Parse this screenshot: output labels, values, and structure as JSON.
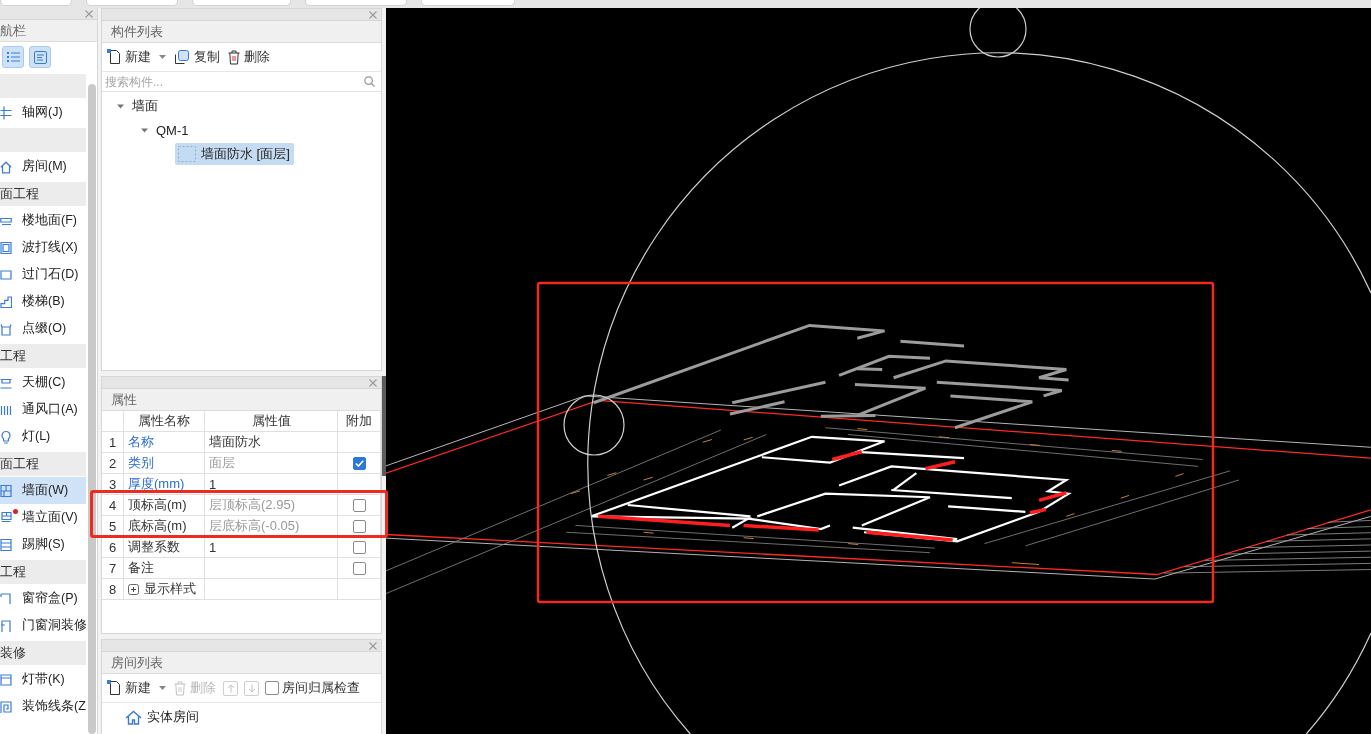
{
  "sidebar": {
    "title": "航栏",
    "groups": [
      {
        "items": [
          {
            "label": "轴网(J)",
            "selected": false,
            "alert_dot": false
          }
        ]
      },
      {
        "items": [
          {
            "label": "房间(M)",
            "selected": false,
            "alert_dot": false
          }
        ]
      },
      {
        "title": "面工程",
        "items": [
          {
            "label": "楼地面(F)",
            "selected": false,
            "alert_dot": false
          },
          {
            "label": "波打线(X)",
            "selected": false,
            "alert_dot": false
          },
          {
            "label": "过门石(D)",
            "selected": false,
            "alert_dot": false
          },
          {
            "label": "楼梯(B)",
            "selected": false,
            "alert_dot": false
          },
          {
            "label": "点缀(O)",
            "selected": false,
            "alert_dot": false
          }
        ]
      },
      {
        "title": "工程",
        "items": [
          {
            "label": "天棚(C)",
            "selected": false,
            "alert_dot": false
          },
          {
            "label": "通风口(A)",
            "selected": false,
            "alert_dot": false
          },
          {
            "label": "灯(L)",
            "selected": false,
            "alert_dot": false
          }
        ]
      },
      {
        "title": "面工程",
        "items": [
          {
            "label": "墙面(W)",
            "selected": true,
            "alert_dot": false
          },
          {
            "label": "墙立面(V)",
            "selected": false,
            "alert_dot": true
          },
          {
            "label": "踢脚(S)",
            "selected": false,
            "alert_dot": false
          }
        ]
      },
      {
        "title": "工程",
        "items": [
          {
            "label": "窗帘盒(P)",
            "selected": false,
            "alert_dot": false
          },
          {
            "label": "门窗洞装修",
            "selected": false,
            "alert_dot": false
          }
        ]
      },
      {
        "title": "装修",
        "items": [
          {
            "label": "灯带(K)",
            "selected": false,
            "alert_dot": false
          },
          {
            "label": "装饰线条(Z",
            "selected": false,
            "alert_dot": false
          }
        ]
      }
    ]
  },
  "component_list": {
    "title": "构件列表",
    "toolbar": [
      {
        "kind": "new",
        "label": "新建",
        "disabled": false
      },
      {
        "kind": "copy",
        "label": "复制",
        "disabled": false
      },
      {
        "kind": "delete",
        "label": "删除",
        "disabled": false
      }
    ],
    "search": {
      "placeholder": "搜索构件..."
    },
    "tree": [
      {
        "label": "墙面",
        "expanded": true,
        "selected": false,
        "children": [
          {
            "label": "QM-1",
            "expanded": true,
            "selected": false,
            "children": [
              {
                "label": "墙面防水 [面层]",
                "selected": true
              }
            ]
          }
        ]
      }
    ]
  },
  "properties": {
    "title": "属性",
    "columns": [
      "属性名称",
      "属性值",
      "附加"
    ],
    "rows": [
      {
        "index": "1",
        "name": "名称",
        "public": true,
        "value": "墙面防水",
        "inherited": false
      },
      {
        "index": "2",
        "name": "类别",
        "public": true,
        "value": "面层",
        "inherited": true,
        "attached": true
      },
      {
        "index": "3",
        "name": "厚度(mm)",
        "public": true,
        "value": "1",
        "inherited": false
      },
      {
        "index": "4",
        "name": "顶标高(m)",
        "public": false,
        "value": "层顶标高(2.95)",
        "inherited": true,
        "attached": false
      },
      {
        "index": "5",
        "name": "底标高(m)",
        "public": false,
        "value": "层底标高(-0.05)",
        "inherited": true,
        "attached": false
      },
      {
        "index": "6",
        "name": "调整系数",
        "public": false,
        "value": "1",
        "inherited": false,
        "attached": false
      },
      {
        "index": "7",
        "name": "备注",
        "public": false,
        "attached": false
      },
      {
        "index": "8",
        "name": "显示样式",
        "public": false,
        "expanded": false
      }
    ]
  },
  "room_list": {
    "title": "房间列表",
    "toolbar": [
      {
        "kind": "new",
        "label": "新建",
        "disabled": false
      },
      {
        "kind": "delete",
        "label": "删除",
        "disabled": true
      },
      {
        "kind": "move_up",
        "disabled": true
      },
      {
        "kind": "move_down",
        "disabled": true
      }
    ],
    "ownership_check": {
      "label": "房间归属检查",
      "checked": false
    },
    "tree": [
      {
        "label": "实体房间",
        "selected": false
      }
    ]
  }
}
